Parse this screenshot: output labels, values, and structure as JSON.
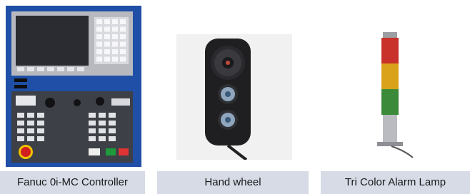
{
  "products": [
    {
      "id": "controller",
      "caption": "Fanuc 0i-MC Controller"
    },
    {
      "id": "handwheel",
      "caption": "Hand wheel"
    },
    {
      "id": "lamp",
      "caption": "Tri Color Alarm Lamp"
    }
  ],
  "colors": {
    "caption_bg": "#d6dbe6",
    "panel_blue": "#1f4fa6",
    "lamp_red": "#c8322a",
    "lamp_amber": "#d9a21a",
    "lamp_green": "#3a8a3a"
  }
}
